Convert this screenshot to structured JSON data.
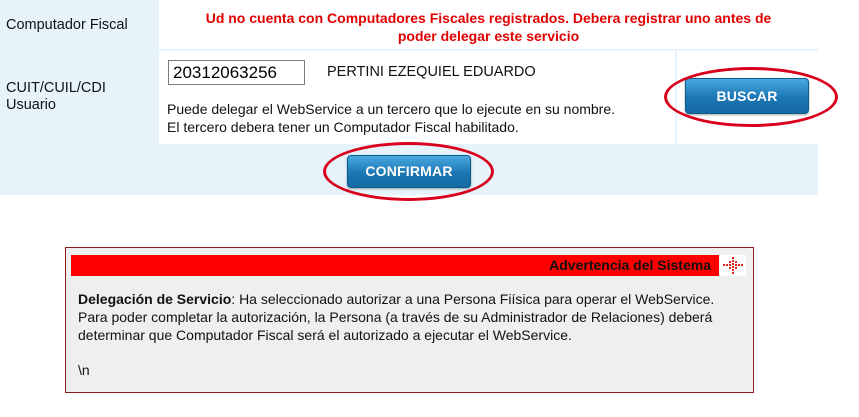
{
  "form": {
    "computador_label": "Computador Fiscal",
    "error_line1": "Ud no cuenta con Computadores Fiscales registrados. Debera registrar uno antes de",
    "error_line2": "poder delegar este servicio",
    "usuario_label_line1": "CUIT/CUIL/CDI",
    "usuario_label_line2": "Usuario",
    "cuit_value": "20312063256",
    "user_name": "PERTINI EZEQUIEL EDUARDO",
    "help_line1": "Puede delegar el WebService a un tercero que lo ejecute en su nombre.",
    "help_line2": "El tercero debera tener un Computador Fiscal habilitado.",
    "buscar_label": "BUSCAR",
    "confirmar_label": "CONFIRMAR"
  },
  "warning": {
    "title": "Advertencia del Sistema",
    "body_bold": "Delegación de Servicio",
    "body_text": ": Ha seleccionado autorizar a una Persona Fiísica para operar el WebService. Para poder completar la autorización, la Persona (a través de su Administrador de Relaciones) deberá determinar que Computador Fiscal será el autorizado a ejecutar el WebService.",
    "trailing": "\\n",
    "icon": "dotted-cross-icon"
  },
  "colors": {
    "error_text": "#e10000",
    "panel_bg": "#e6f3fb",
    "button": "#1a76b3",
    "highlight_ring": "#d9001c",
    "warning_bar": "#ff0000"
  }
}
